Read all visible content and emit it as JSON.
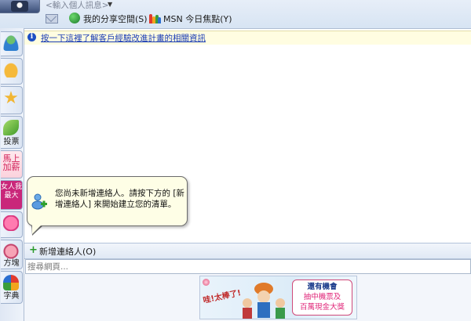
{
  "header": {
    "personal_message": "<輸入個人訊息>",
    "links": [
      {
        "label": "我的分享空間(S)"
      },
      {
        "label": "MSN 今日焦點(Y)"
      }
    ]
  },
  "sidebar": {
    "tabs": [
      {
        "label": ""
      },
      {
        "label": ""
      },
      {
        "label": ""
      },
      {
        "label": "投票"
      },
      {
        "label": "馬上加薪"
      },
      {
        "label": "女人我最大"
      },
      {
        "label": ""
      },
      {
        "label": "方塊"
      },
      {
        "label": "字典"
      }
    ]
  },
  "info_bar": {
    "link": "按一下這裡了解客戶經驗改進計畫的相關資訊"
  },
  "tooltip": {
    "text": "您尚未新增連絡人。請按下方的 [新增連絡人] 來開始建立您的清單。"
  },
  "add_contact": {
    "label": "新增連絡人(O)"
  },
  "search": {
    "placeholder": "搜尋網頁..."
  },
  "ad": {
    "slogan": "哇!太棒了!",
    "line1": "還有機會",
    "line2": "抽中機票及",
    "line3": "百萬現金大獎"
  },
  "colors": {
    "accent": "#1e395b",
    "link": "#1a3cb5",
    "info_background": "#fffde1",
    "tooltip_background": "#fefee6",
    "plus_green": "#2a9a2a"
  },
  "icons": [
    "avatar-picture",
    "mail-icon",
    "share-space-icon",
    "msn-butterfly-icon",
    "info-icon",
    "add-contact-icon",
    "plus-icon"
  ]
}
